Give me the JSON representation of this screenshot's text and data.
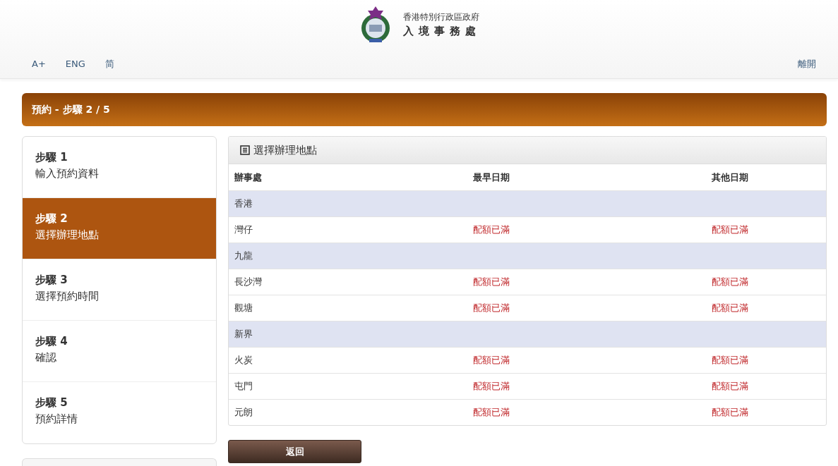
{
  "header": {
    "org_line1": "香港特別行政區政府",
    "org_line2": "入 境 事 務 處"
  },
  "nav": {
    "links": [
      "A+",
      "ENG",
      "简"
    ],
    "exit": "離開"
  },
  "title_bar": "預約 - 步驟 2 / 5",
  "steps": [
    {
      "number": "步驟 1",
      "label": "輸入預約資料",
      "selected": false
    },
    {
      "number": "步驟 2",
      "label": "選擇辦理地點",
      "selected": true
    },
    {
      "number": "步驟 3",
      "label": "選擇預約時間",
      "selected": false
    },
    {
      "number": "步驟 4",
      "label": "確認",
      "selected": false
    },
    {
      "number": "步驟 5",
      "label": "預約詳情",
      "selected": false
    }
  ],
  "panel": {
    "title": "選擇辦理地點",
    "table": {
      "columns": [
        "辦事處",
        "最早日期",
        "其他日期"
      ],
      "rows": [
        {
          "kind": "region",
          "cells": [
            "香港"
          ]
        },
        {
          "kind": "office",
          "cells": [
            "灣仔",
            "配額已滿",
            "配額已滿"
          ]
        },
        {
          "kind": "region",
          "cells": [
            "九龍"
          ]
        },
        {
          "kind": "office",
          "cells": [
            "長沙灣",
            "配額已滿",
            "配額已滿"
          ]
        },
        {
          "kind": "office",
          "cells": [
            "觀塘",
            "配額已滿",
            "配額已滿"
          ]
        },
        {
          "kind": "region",
          "cells": [
            "新界"
          ]
        },
        {
          "kind": "office",
          "cells": [
            "火炭",
            "配額已滿",
            "配額已滿"
          ]
        },
        {
          "kind": "office",
          "cells": [
            "屯門",
            "配額已滿",
            "配額已滿"
          ]
        },
        {
          "kind": "office",
          "cells": [
            "元朗",
            "配額已滿",
            "配額已滿"
          ]
        }
      ]
    }
  },
  "back_button": "返回"
}
